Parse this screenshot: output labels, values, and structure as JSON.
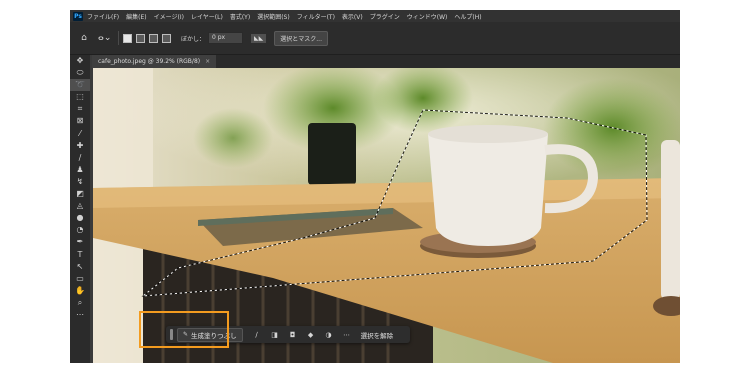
{
  "menubar": {
    "logo": "Ps",
    "items": [
      "ファイル(F)",
      "編集(E)",
      "イメージ(I)",
      "レイヤー(L)",
      "書式(Y)",
      "選択範囲(S)",
      "フィルター(T)",
      "表示(V)",
      "プラグイン",
      "ウィンドウ(W)",
      "ヘルプ(H)"
    ]
  },
  "options": {
    "home_icon": "home-icon",
    "tool_icon": "lasso-icon",
    "feather_label": "ぼかし：",
    "feather_value": "0 px",
    "antialias_label": "◣◣",
    "select_mask_label": "選択とマスク..."
  },
  "document": {
    "tab_title": "cafe_photo.jpeg @ 39.2% (RGB/8)",
    "tab_close": "×"
  },
  "tools": [
    "move-tool-icon",
    "marquee-tool-icon",
    "lasso-tool-icon",
    "object-select-tool-icon",
    "crop-tool-icon",
    "frame-tool-icon",
    "eyedropper-tool-icon",
    "healing-brush-icon",
    "brush-tool-icon",
    "stamp-tool-icon",
    "history-brush-icon",
    "eraser-tool-icon",
    "gradient-tool-icon",
    "blur-tool-icon",
    "dodge-tool-icon",
    "pen-tool-icon",
    "type-tool-icon",
    "path-select-icon",
    "rectangle-tool-icon",
    "hand-tool-icon",
    "zoom-tool-icon",
    "more-tools-icon"
  ],
  "taskbar": {
    "generative_fill_label": "生成塗りつぶし",
    "deselect_label": "選択を解除"
  },
  "colors": {
    "highlight": "#f39b1f",
    "ui_dark": "#2b2b2b"
  }
}
